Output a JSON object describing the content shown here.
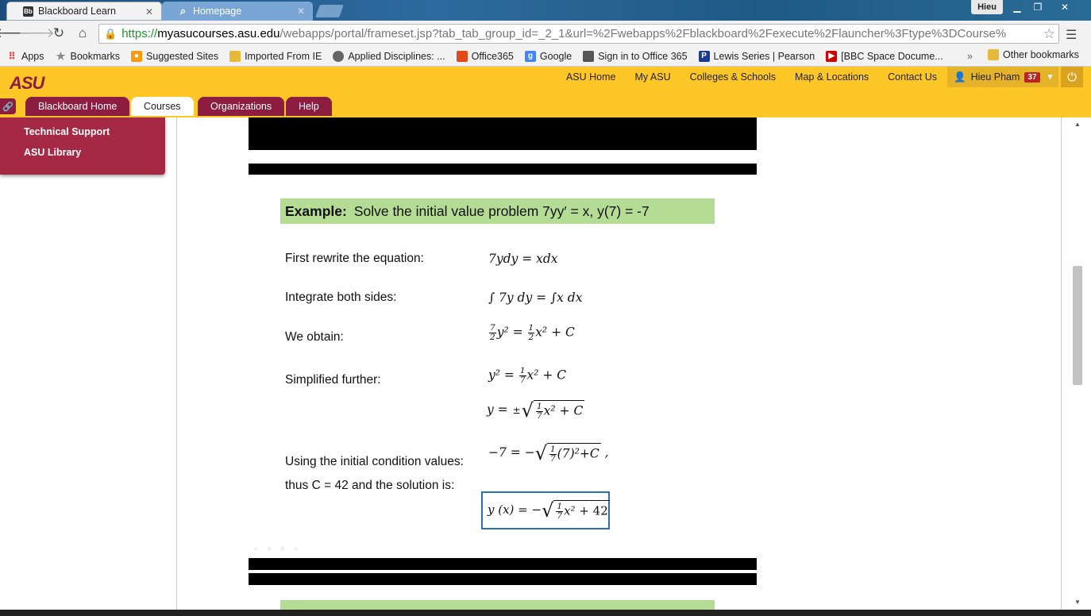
{
  "browser": {
    "tabs": [
      {
        "label": "Blackboard Learn",
        "icon": "Bb"
      },
      {
        "label": "Homepage",
        "icon": "search-icon"
      }
    ],
    "user": "Hieu",
    "url": {
      "scheme": "https://",
      "host": "myasucourses.asu.edu",
      "path": "/webapps/portal/frameset.jsp?tab_tab_group_id=_2_1&url=%2Fwebapps%2Fblackboard%2Fexecute%2Flauncher%3Ftype%3DCourse%"
    },
    "bookmarks": [
      {
        "label": "Apps",
        "icon": "apps-icon"
      },
      {
        "label": "Bookmarks",
        "icon": "star-icon"
      },
      {
        "label": "Suggested Sites",
        "icon": "suggested-icon"
      },
      {
        "label": "Imported From IE",
        "icon": "folder-icon"
      },
      {
        "label": "Applied Disciplines: ...",
        "icon": "page-icon"
      },
      {
        "label": "Office365",
        "icon": "office-icon"
      },
      {
        "label": "Google",
        "icon": "google-icon"
      },
      {
        "label": "Sign in to Office 365",
        "icon": "office-icon"
      },
      {
        "label": "Lewis Series | Pearson",
        "icon": "pearson-icon"
      },
      {
        "label": "[BBC Space Docume...",
        "icon": "youtube-icon"
      }
    ],
    "more": "»",
    "other_bookmarks": "Other bookmarks"
  },
  "asu": {
    "logo": "ASU",
    "top_links": [
      "ASU Home",
      "My ASU",
      "Colleges & Schools",
      "Map & Locations",
      "Contact Us"
    ],
    "user_name": "Hieu Pham",
    "notifications": "37",
    "nav_tabs": [
      {
        "label": "Blackboard Home",
        "active": false
      },
      {
        "label": "Courses",
        "active": true
      },
      {
        "label": "Organizations",
        "active": false
      },
      {
        "label": "Help",
        "active": false
      }
    ],
    "sidebar": [
      "Technical Support",
      "ASU Library"
    ]
  },
  "slide": {
    "example_label": "Example:",
    "example_text": "Solve the initial value problem 7yy′ = x, y(7) = -7",
    "steps": [
      {
        "label": "First rewrite the equation:"
      },
      {
        "label": "Integrate both sides:"
      },
      {
        "label": "We obtain:"
      },
      {
        "label": "Simplified further:"
      },
      {
        "label": "Using the initial condition values:"
      },
      {
        "label": "thus  C = 42 and the solution is:"
      }
    ],
    "math": {
      "rewrite": "7ydy = xdx",
      "integrate": "∫ 7y dy = ∫x dx",
      "c_value": "42"
    }
  }
}
